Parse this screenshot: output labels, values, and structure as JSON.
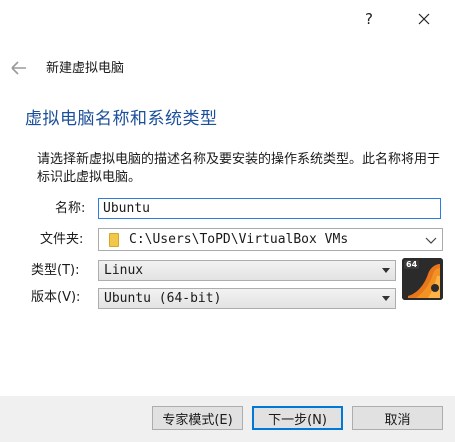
{
  "titlebar": {
    "help_label": "?",
    "close_icon": "close-icon"
  },
  "header": {
    "back_icon": "back-arrow-icon",
    "wizard_title": "新建虚拟电脑"
  },
  "page": {
    "heading": "虚拟电脑名称和系统类型",
    "description": "请选择新虚拟电脑的描述名称及要安装的操作系统类型。此名称将用于标识此虚拟电脑。"
  },
  "form": {
    "name_label": "名称:",
    "name_value": "Ubuntu",
    "folder_label": "文件夹:",
    "folder_value": "C:\\Users\\ToPD\\VirtualBox VMs",
    "type_label": "类型(T):",
    "type_value": "Linux",
    "version_label": "版本(V):",
    "version_value": "Ubuntu (64-bit)",
    "os_badge_bits": "64"
  },
  "buttons": {
    "expert": "专家模式(E)",
    "next": "下一步(N)",
    "cancel": "取消"
  },
  "colors": {
    "heading": "#1b4f9c",
    "focus_border": "#2b7de0",
    "footer_bg": "#f0f0f0"
  }
}
